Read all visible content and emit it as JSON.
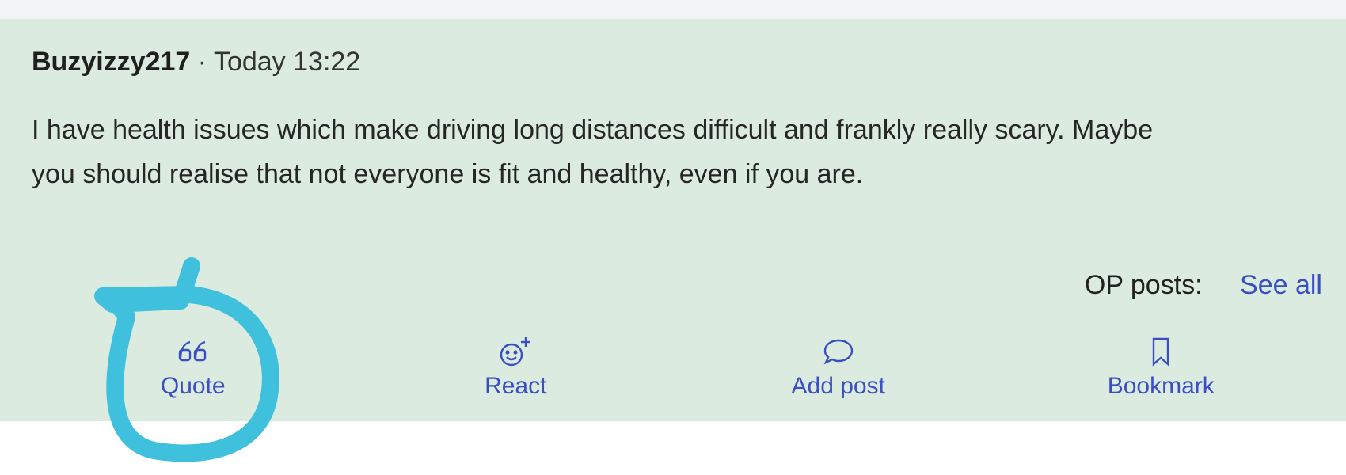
{
  "post": {
    "author": "Buzyizzy217",
    "separator": "·",
    "timestamp": "Today 13:22",
    "body": "I have health issues which make driving long distances difficult and frankly really scary. Maybe you should realise that not everyone is fit and healthy, even if you are.",
    "op_posts_label": "OP posts:",
    "see_all_label": "See all"
  },
  "actions": [
    {
      "label": "Quote",
      "icon": "quote-icon"
    },
    {
      "label": "React",
      "icon": "emoji-plus-icon"
    },
    {
      "label": "Add post",
      "icon": "speech-bubble-icon"
    },
    {
      "label": "Bookmark",
      "icon": "bookmark-icon"
    }
  ],
  "colors": {
    "post_background": "#dcebdf",
    "link": "#3b4fc4",
    "annotation": "#3fc1de"
  }
}
